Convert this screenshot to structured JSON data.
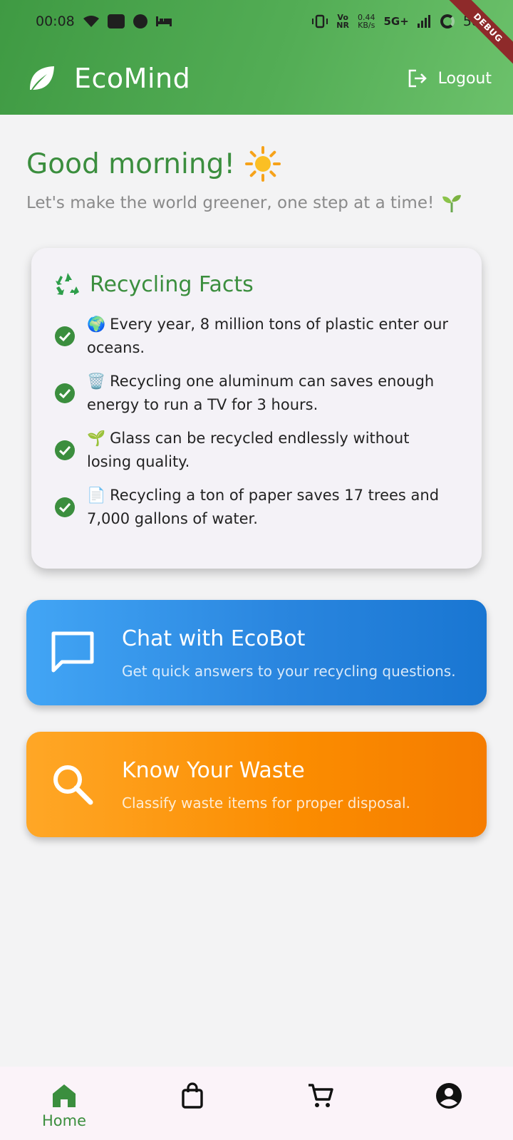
{
  "status_bar": {
    "time": "00:08",
    "network_speed": "0.44",
    "network_unit": "KB/s",
    "volte": "Vo",
    "nr": "NR",
    "network_type": "5G+",
    "battery": "58"
  },
  "debug_banner": "DEBUG",
  "app_bar": {
    "title": "EcoMind",
    "logout_label": "Logout"
  },
  "greeting": {
    "title": "Good morning!",
    "subtitle": "Let's make the world greener, one step at a time!"
  },
  "facts": {
    "title": "Recycling Facts",
    "items": [
      {
        "emoji": "🌍",
        "text": "Every year, 8 million tons of plastic enter our oceans."
      },
      {
        "emoji": "🗑️",
        "text": "Recycling one aluminum can saves enough energy to run a TV for 3 hours."
      },
      {
        "emoji": "🌱",
        "text": "Glass can be recycled endlessly without losing quality."
      },
      {
        "emoji": "📄",
        "text": "Recycling a ton of paper saves 17 trees and 7,000 gallons of water."
      }
    ]
  },
  "cards": {
    "chat": {
      "title": "Chat with EcoBot",
      "description": "Get quick answers to your recycling questions.",
      "icon": "chat-bubble-icon"
    },
    "waste": {
      "title": "Know Your Waste",
      "description": "Classify waste items for proper disposal.",
      "icon": "search-icon"
    }
  },
  "bottom_nav": {
    "items": [
      {
        "label": "Home",
        "icon": "home-icon",
        "active": true
      },
      {
        "label": "",
        "icon": "shopping-bag-icon",
        "active": false
      },
      {
        "label": "",
        "icon": "cart-icon",
        "active": false
      },
      {
        "label": "",
        "icon": "account-icon",
        "active": false
      }
    ]
  },
  "colors": {
    "primary_green": "#3b8e3e",
    "chat_blue": "#1976d2",
    "waste_orange": "#f57c00",
    "background": "#f3f3f4"
  }
}
